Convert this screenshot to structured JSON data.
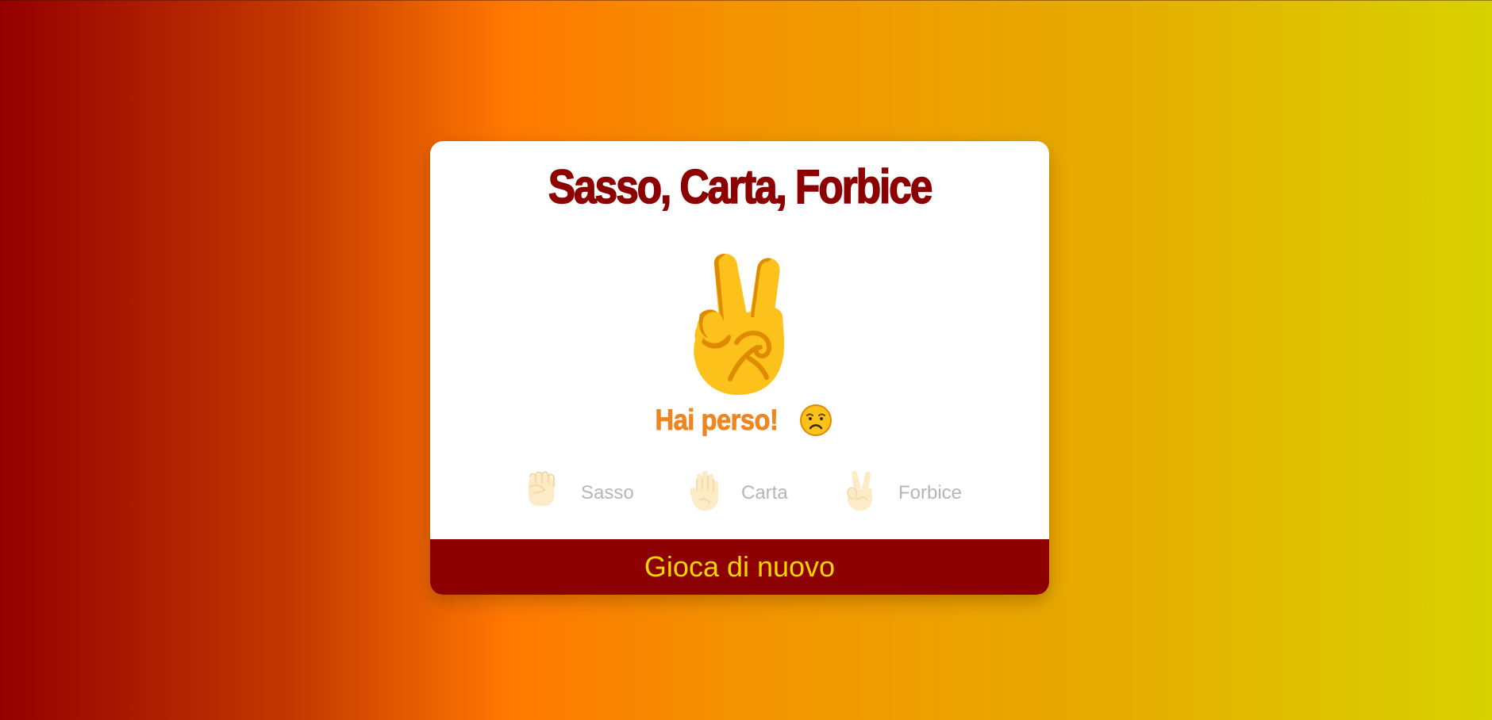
{
  "game": {
    "title": "Sasso, Carta, Forbice",
    "computer_choice_icon": "victory-hand-icon",
    "result_text": "Hai perso!",
    "result_emoji": "sad-face-icon"
  },
  "choices": [
    {
      "label": "Sasso",
      "icon": "raised-fist-icon"
    },
    {
      "label": "Carta",
      "icon": "raised-hand-icon"
    },
    {
      "label": "Forbice",
      "icon": "victory-hand-icon"
    }
  ],
  "actions": {
    "play_again_label": "Gioca di nuovo"
  },
  "colors": {
    "title": "#8d0000",
    "result": "#f08520",
    "button_bg": "#8d0000",
    "button_text": "#ffd600",
    "choice_label": "#b6b6b6"
  }
}
